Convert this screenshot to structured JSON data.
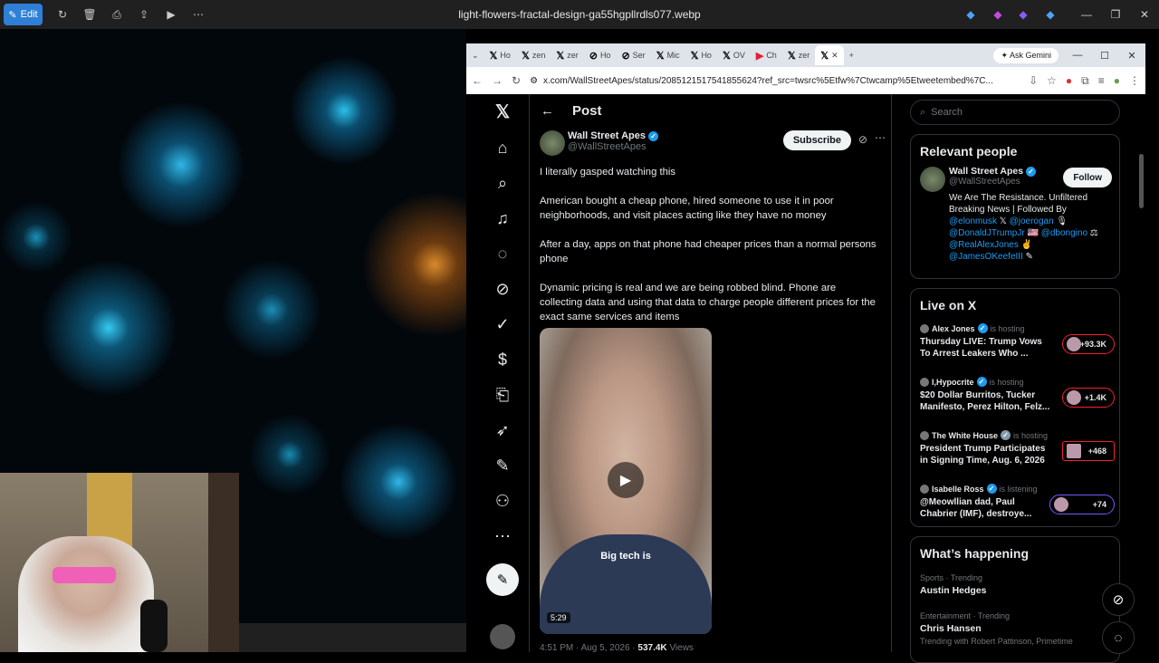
{
  "viewer": {
    "edit_label": "Edit",
    "title": "light-flowers-fractal-design-ga55hgpllrdls077.webp"
  },
  "browser": {
    "tabs": [
      "Ho",
      "zen",
      "zer",
      "Ho",
      "Ser",
      "Mic",
      "Ho",
      "OV",
      "Ch",
      "zer"
    ],
    "gemini_label": "Ask Gemini",
    "url": "x.com/WallStreetApes/status/2085121517541855624?ref_src=twsrc%5Etfw%7Ctwcamp%5Etweetembed%7C..."
  },
  "post": {
    "header": "Post",
    "author_name": "Wall Street Apes",
    "author_handle": "@WallStreetApes",
    "subscribe_label": "Subscribe",
    "paragraphs": [
      "I literally gasped watching this",
      "American bought a cheap phone, hired someone to use it in poor neighborhoods, and visit places acting like they have no money",
      "After a day, apps on that phone had cheaper prices than a normal persons phone",
      "Dynamic pricing is real and we are being robbed blind. Phone are collecting data and using that data to charge people different prices for the exact same services and items"
    ],
    "video_caption": "Big tech is",
    "video_duration": "5:29",
    "meta_time": "4:51 PM · Aug 5, 2026 ·",
    "meta_views": "537.4K",
    "meta_views_label": "Views"
  },
  "sidebar": {
    "search_placeholder": "Search",
    "relevant_title": "Relevant people",
    "rp_name": "Wall Street Apes",
    "rp_handle": "@WallStreetApes",
    "follow_label": "Follow",
    "rp_bio_1": "We Are The Resistance. Unfiltered Breaking News | Followed By",
    "rp_mention_1": "@elonmusk",
    "rp_mention_2": "@joerogan",
    "rp_mention_3": "@DonaldJTrumpJr",
    "rp_mention_4": "@dbongino",
    "rp_mention_5": "@RealAlexJones",
    "rp_mention_6": "@JamesOKeefeIII",
    "live_title": "Live on X",
    "live": [
      {
        "host": "Alex Jones",
        "status": "is hosting",
        "title": "Thursday LIVE: Trump Vows To Arrest Leakers Who ...",
        "count": "+93.3K"
      },
      {
        "host": "I,Hypocrite",
        "status": "is hosting",
        "title": "$20 Dollar Burritos, Tucker Manifesto, Perez Hilton, Felz...",
        "count": "+1.4K"
      },
      {
        "host": "The White House",
        "status": "is hosting",
        "title": "President Trump Participates in Signing Time, Aug. 6, 2026",
        "count": "+468"
      },
      {
        "host": "Isabelle Ross",
        "status": "is listening",
        "title": "@Meowllian dad, Paul Chabrier (IMF), destroye...",
        "count": "+74"
      }
    ],
    "happening_title": "What’s happening",
    "trends": [
      {
        "category": "Sports · Trending",
        "name": "Austin Hedges",
        "sub": ""
      },
      {
        "category": "Entertainment · Trending",
        "name": "Chris Hansen",
        "sub": "Trending with Robert Pattinson, Primetime"
      }
    ]
  },
  "colors": {
    "accent": "#1d9bf0",
    "live_ring": "#f4212e",
    "edit_button": "#2f7fd6"
  }
}
